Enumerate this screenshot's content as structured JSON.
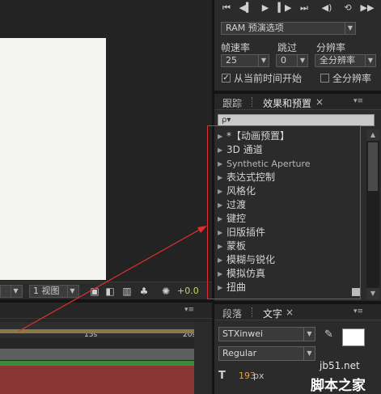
{
  "viewer_bar": {
    "view_count": "1 视图",
    "exposure": "+0.0"
  },
  "preview": {
    "ram_preview": "RAM 预演选项",
    "frame_rate_label": "帧速率",
    "skip_label": "跳过",
    "resolution_label": "分辨率",
    "frame_rate_value": "25",
    "skip_value": "0",
    "resolution_value": "全分辨率",
    "from_current_label": "从当前时间开始",
    "from_current_checked": true,
    "full_screen_label": "全分辨率",
    "full_screen_checked": false
  },
  "effects_panel": {
    "tab_tracker": "跟踪",
    "tab_effects": "效果和预置",
    "close_glyph": "×",
    "menu_glyph": "▾≡",
    "search_value": "ρ▾",
    "items": [
      {
        "label": "*【动画预置】"
      },
      {
        "label": "3D 通道"
      },
      {
        "label": "Synthetic Aperture"
      },
      {
        "label": "表达式控制"
      },
      {
        "label": "风格化"
      },
      {
        "label": "过渡"
      },
      {
        "label": "键控"
      },
      {
        "label": "旧版插件"
      },
      {
        "label": "蒙板"
      },
      {
        "label": "模糊与锐化"
      },
      {
        "label": "模拟仿真"
      },
      {
        "label": "扭曲"
      }
    ]
  },
  "timeline": {
    "menu_glyph": "▾≡",
    "tick_15s": "15s",
    "tick_20s": "20s"
  },
  "character_panel": {
    "tab_paragraph": "段落",
    "tab_character": "文字",
    "close_glyph": "×",
    "menu_glyph": "▾≡",
    "font_family": "STXinwei",
    "font_style": "Regular",
    "font_size_value": "193",
    "font_size_unit": "px"
  },
  "watermark": {
    "line1": "jb51.net",
    "line2": "脚本之家"
  },
  "colors": {
    "annotation_red": "#e0302e",
    "panel_bg": "#2b2b2b",
    "exposure_yellow": "#cbd65b"
  }
}
